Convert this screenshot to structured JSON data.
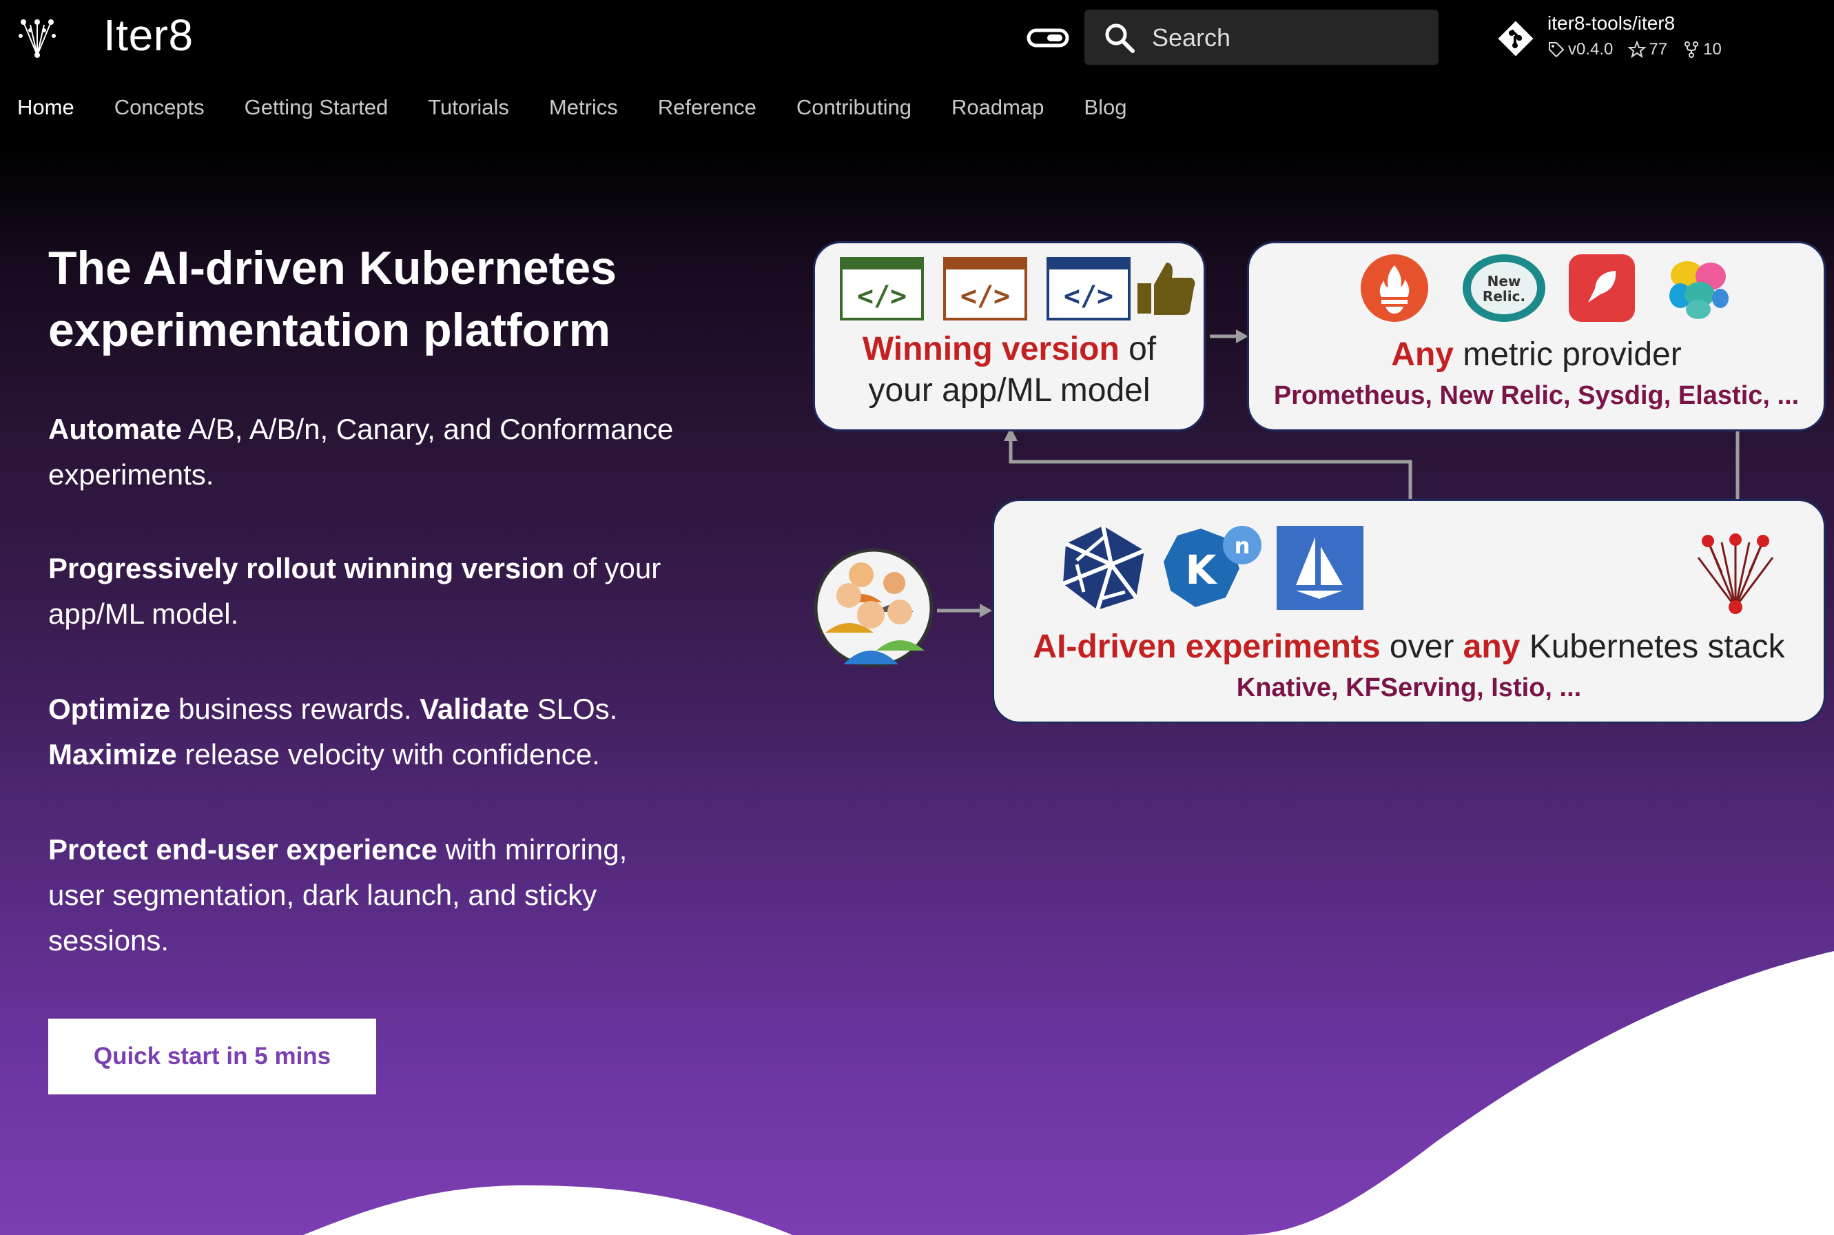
{
  "header": {
    "brand": "Iter8",
    "search_placeholder": "Search",
    "repo": {
      "name": "iter8-tools/iter8",
      "version": "v0.4.0",
      "stars": "77",
      "forks": "10"
    },
    "nav": [
      "Home",
      "Concepts",
      "Getting Started",
      "Tutorials",
      "Metrics",
      "Reference",
      "Contributing",
      "Roadmap",
      "Blog"
    ],
    "active_nav": "Home"
  },
  "hero": {
    "title_line1": "The AI-driven Kubernetes",
    "title_line2": "experimentation platform",
    "p1": {
      "bold": "Automate",
      "rest": " A/B, A/B/n, Canary, and Conformance experiments."
    },
    "p2": {
      "bold": "Progressively rollout winning version",
      "rest": " of your app/ML model."
    },
    "p3": {
      "bold1": "Optimize",
      "rest1": " business rewards. ",
      "bold2": "Validate",
      "rest2": " SLOs. ",
      "bold3": "Maximize",
      "rest3": " release velocity with confidence."
    },
    "p4": {
      "bold": "Protect end-user experience",
      "rest": " with mirroring, user segmentation, dark launch, and sticky sessions."
    },
    "cta": "Quick start in 5 mins"
  },
  "diagram": {
    "winning": {
      "red": "Winning version",
      "rest": " of",
      "line2": "your app/ML model"
    },
    "metric": {
      "red": "Any",
      "rest": " metric provider",
      "providers": "Prometheus, New Relic, Sysdig,  Elastic, ..."
    },
    "ai": {
      "red1": "AI-driven experiments",
      "mid": " over ",
      "red2": "any",
      "rest": " Kubernetes stack",
      "stacks": "Knative, KFServing, Istio, ..."
    },
    "newrelic_label": "New Relic.",
    "knative_letter": "K",
    "knative_badge": "n"
  },
  "colors": {
    "accent": "#7a3fb0",
    "red": "#c32121",
    "maroon": "#7a1447"
  }
}
